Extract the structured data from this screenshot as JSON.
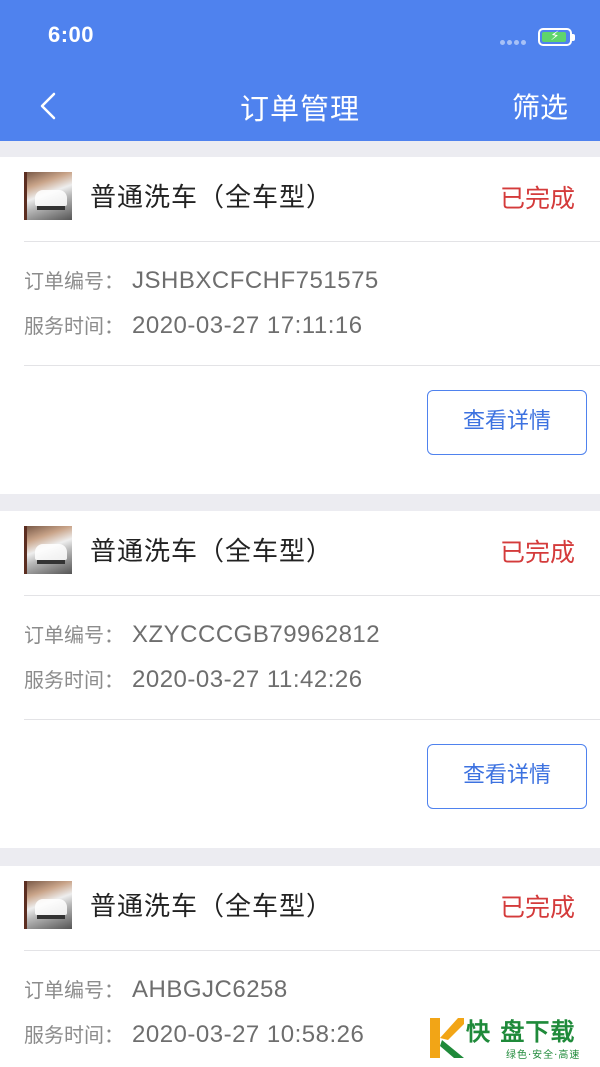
{
  "status_bar": {
    "time": "6:00"
  },
  "nav": {
    "title": "订单管理",
    "filter_label": "筛选"
  },
  "orders": [
    {
      "service": "普通洗车（全车型）",
      "status": "已完成",
      "order_label": "订单编号：",
      "order_no": "JSHBXCFCHF751575",
      "time_label": "服务时间：",
      "service_time": "2020-03-27 17:11:16",
      "button": "查看详情"
    },
    {
      "service": "普通洗车（全车型）",
      "status": "已完成",
      "order_label": "订单编号：",
      "order_no": "XZYCCCGB79962812",
      "time_label": "服务时间：",
      "service_time": "2020-03-27 11:42:26",
      "button": "查看详情"
    },
    {
      "service": "普通洗车（全车型）",
      "status": "已完成",
      "order_label": "订单编号：",
      "order_no": "AHBGJC6258",
      "time_label": "服务时间：",
      "service_time": "2020-03-27 10:58:26"
    }
  ],
  "watermark": {
    "title": "快 盘下载",
    "subtitle": "绿色·安全·高速"
  },
  "colors": {
    "header": "#4f82ee",
    "status_done": "#d43b3b",
    "button_text": "#3d72e0",
    "background": "#ececf1"
  }
}
